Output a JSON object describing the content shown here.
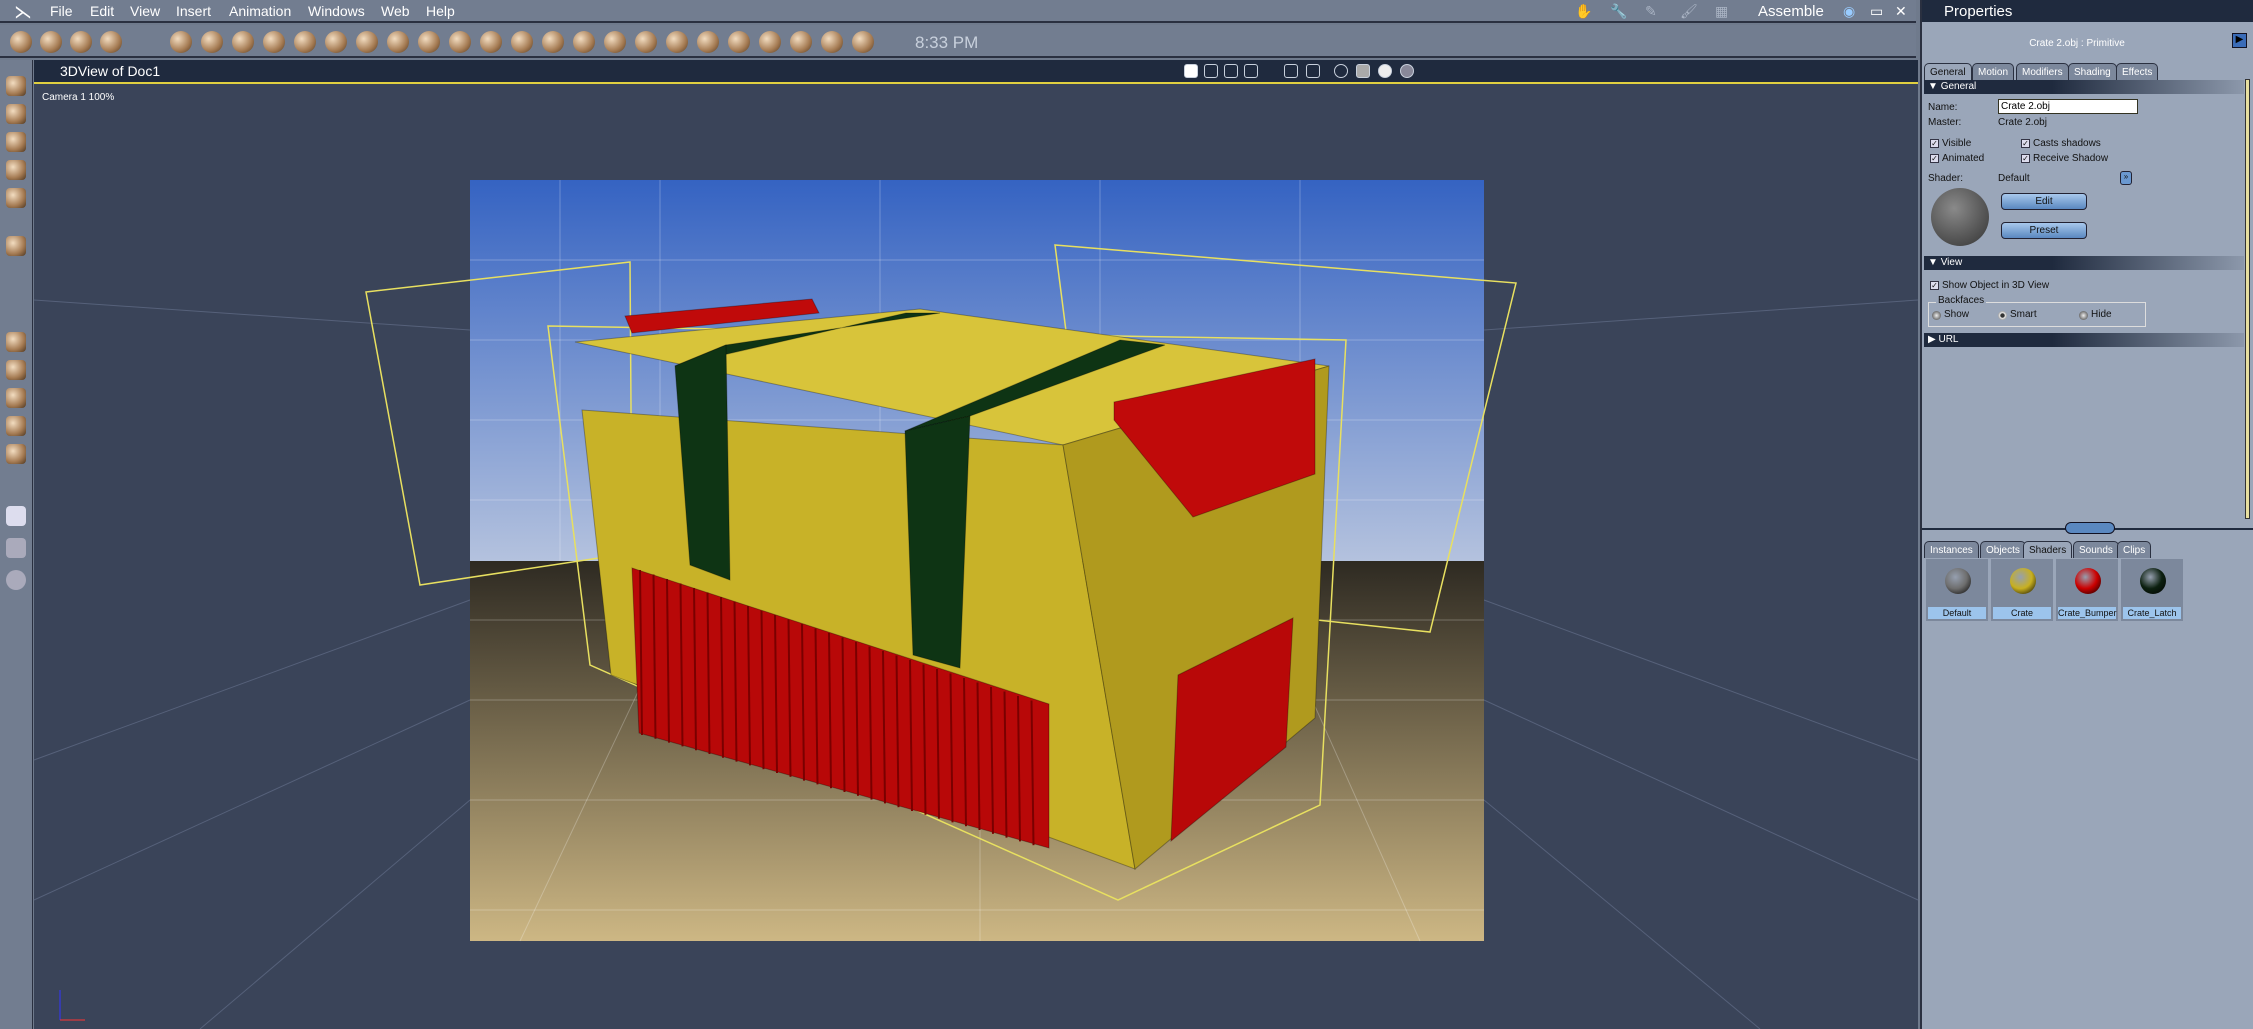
{
  "menu": {
    "items": [
      "File",
      "Edit",
      "View",
      "Insert",
      "Animation",
      "Windows",
      "Web",
      "Help"
    ]
  },
  "toolbar": {
    "icons": [
      "pose-tool-icon",
      "hand-tool-icon",
      "wrench-tool-icon",
      "paint-tool-icon",
      "sphere-icon",
      "goblet-icon",
      "globe-icon",
      "bone-chain-icon",
      "torus-icon",
      "text-icon",
      "particles-icon",
      "terrain-icon",
      "tree-icon",
      "cloud-icon",
      "fire-icon",
      "rock-icon",
      "grass-icon",
      "agr-icon",
      "film-icon",
      "house-icon",
      "basket-icon",
      "blob-icon",
      "spotlight-icon",
      "camera-icon",
      "hierarchy-icon",
      "target-icon",
      "bone-icon"
    ],
    "clock": "8:33 PM"
  },
  "rooms": {
    "label": "Assemble",
    "icons": [
      "assemble-hand-icon",
      "modifiers-wrench-icon",
      "pencil-icon",
      "brush-icon",
      "film-strip-icon"
    ]
  },
  "view": {
    "title": "3DView of Doc1",
    "camera": "Camera 1 100%"
  },
  "properties": {
    "title": "Properties",
    "object": "Crate 2.obj : Primitive",
    "tabs": [
      "General",
      "Motion",
      "Modifiers",
      "Shading",
      "Effects"
    ],
    "general": {
      "header": "General",
      "name_label": "Name:",
      "name_value": "Crate 2.obj",
      "master_label": "Master:",
      "master_value": "Crate 2.obj",
      "visible": "Visible",
      "animated": "Animated",
      "casts": "Casts shadows",
      "receive": "Receive Shadow",
      "shader_label": "Shader:",
      "shader_value": "Default",
      "edit": "Edit",
      "preset": "Preset"
    },
    "viewsec": {
      "header": "View",
      "show_object": "Show Object in 3D View",
      "backfaces": "Backfaces",
      "show": "Show",
      "smart": "Smart",
      "hide": "Hide",
      "selected": "Smart"
    },
    "url": {
      "header": "URL"
    }
  },
  "library": {
    "tabs": [
      "Instances",
      "Objects",
      "Shaders",
      "Sounds",
      "Clips"
    ],
    "active": "Shaders",
    "shaders": [
      {
        "name": "Default",
        "color": "#6e6e6e"
      },
      {
        "name": "Crate",
        "color": "#c8b020"
      },
      {
        "name": "Crate_Bumper",
        "color": "#cc0000"
      },
      {
        "name": "Crate_Latch",
        "color": "#0c2010"
      }
    ]
  },
  "colors": {
    "crate": "#c8b228",
    "bumper": "#c00a0a",
    "latch": "#0e3414",
    "selection": "#e8e060"
  }
}
